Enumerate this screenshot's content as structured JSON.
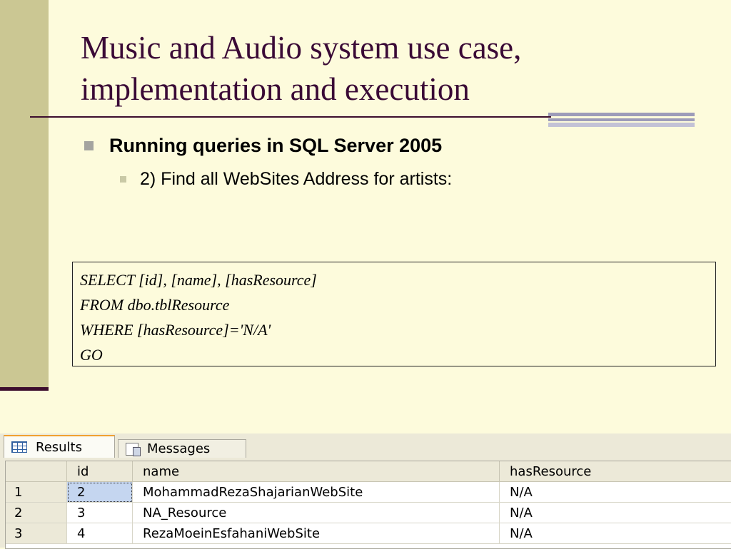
{
  "slide": {
    "title_line1": "Music and Audio system use case,",
    "title_line2": "implementation and execution",
    "bullet_level1": "Running queries in SQL Server 2005",
    "bullet_level2": "2) Find all WebSites Address for artists:"
  },
  "sql": {
    "lines": [
      "SELECT [id], [name], [hasResource]",
      "FROM dbo.tblResource",
      "WHERE [hasResource]='N/A'",
      "GO"
    ]
  },
  "results_panel": {
    "tabs": [
      {
        "label": "Results",
        "icon": "grid-icon",
        "active": true
      },
      {
        "label": "Messages",
        "icon": "messages-icon",
        "active": false
      }
    ],
    "columns": [
      "",
      "id",
      "name",
      "hasResource"
    ],
    "rows": [
      {
        "rownum": "1",
        "id": "2",
        "name": "MohammadRezaShajarianWebSite",
        "hasResource": "N/A"
      },
      {
        "rownum": "2",
        "id": "3",
        "name": "NA_Resource",
        "hasResource": "N/A"
      },
      {
        "rownum": "3",
        "id": "4",
        "name": "RezaMoeinEsfahaniWebSite",
        "hasResource": "N/A"
      }
    ]
  },
  "colors": {
    "background": "#fdfbdc",
    "left_band": "#cbc793",
    "title": "#3a0a36",
    "accent_bars": "#9d9cb9"
  }
}
